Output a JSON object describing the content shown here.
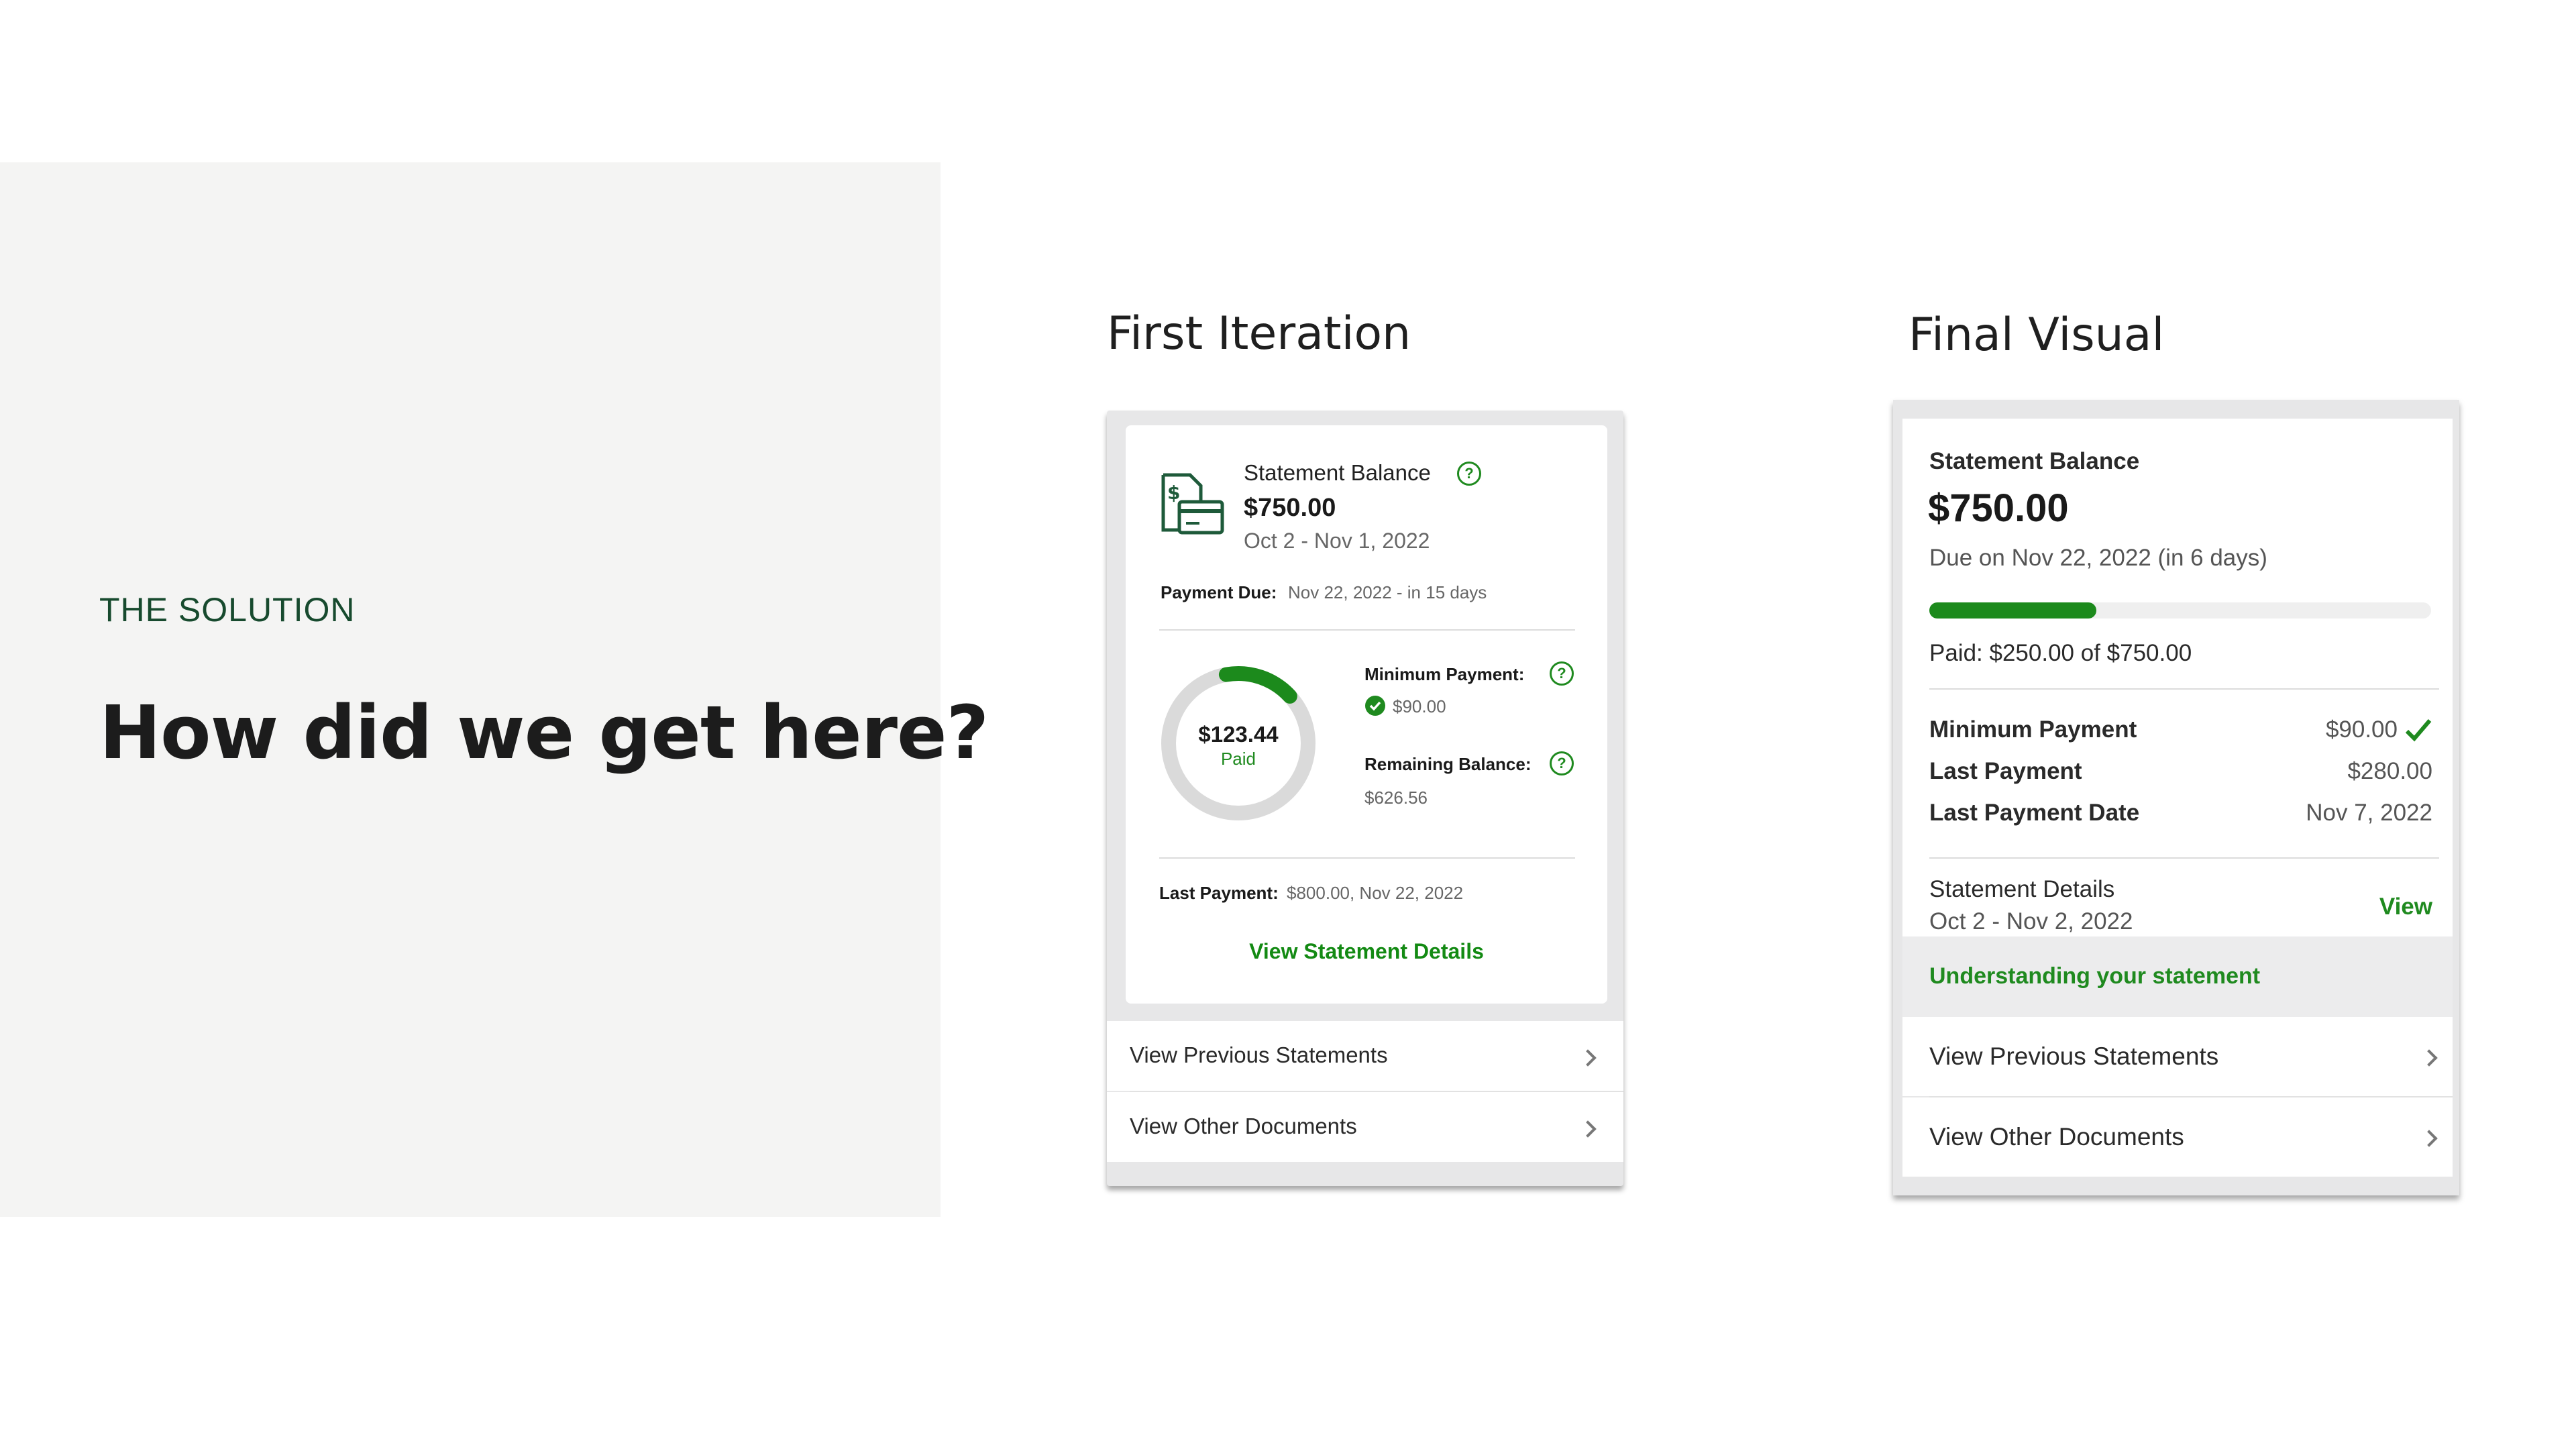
{
  "slide": {
    "eyebrow": "THE SOLUTION",
    "headline": "How did we get here?",
    "first_title": "First Iteration",
    "final_title": "Final Visual"
  },
  "colors": {
    "accent_green": "#1f8a1f",
    "panel_gray": "#f4f4f3",
    "heading_green": "#174a2e"
  },
  "first_iteration": {
    "statement_label": "Statement Balance",
    "balance": "$750.00",
    "period": "Oct 2 - Nov 1, 2022",
    "payment_due_label": "Payment Due:",
    "payment_due_value": "Nov 22, 2022 - in 15 days",
    "donut_amount": "$123.44",
    "donut_label": "Paid",
    "donut_paid_fraction": 0.16,
    "minimum_payment_label": "Minimum Payment:",
    "minimum_payment_value": "$90.00",
    "remaining_balance_label": "Remaining Balance:",
    "remaining_balance_value": "$626.56",
    "last_payment_label": "Last Payment:",
    "last_payment_value": "$800.00, Nov 22, 2022",
    "view_details_link": "View Statement Details",
    "list": [
      {
        "label": "View Previous Statements"
      },
      {
        "label": "View Other Documents"
      }
    ],
    "icons": [
      "bill-card-icon",
      "help-icon",
      "check-circle-icon",
      "chevron-right-icon"
    ]
  },
  "final_visual": {
    "statement_label": "Statement Balance",
    "balance": "$750.00",
    "due_text": "Due on Nov 22, 2022 (in 6 days)",
    "progress_fraction": 0.3333,
    "paid_text": "Paid: $250.00 of $750.00",
    "rows": [
      {
        "label": "Minimum Payment",
        "value": "$90.00"
      },
      {
        "label": "Last Payment",
        "value": "$280.00"
      },
      {
        "label": "Last Payment Date",
        "value": "Nov 7, 2022"
      }
    ],
    "details_label": "Statement Details",
    "details_period": "Oct 2 - Nov 2, 2022",
    "view_link": "View",
    "understanding_link": "Understanding your statement",
    "list": [
      {
        "label": "View Previous Statements"
      },
      {
        "label": "View Other Documents"
      }
    ],
    "icons": [
      "check-icon",
      "chevron-right-icon"
    ]
  }
}
